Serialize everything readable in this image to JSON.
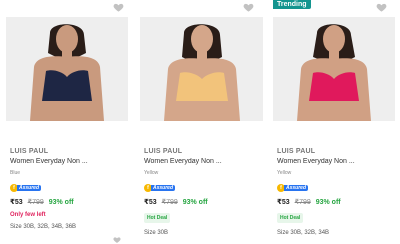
{
  "products": [
    {
      "brand": "LUIS PAUL",
      "title": "Women Everyday Non ...",
      "color": "Blue",
      "assured": "Assured",
      "price": "₹53",
      "mrp": "₹799",
      "off": "93% off",
      "tag": "Only few left",
      "sizes": "Size 30B, 32B, 34B, 36B",
      "bra_color": "#1e2644",
      "trending": ""
    },
    {
      "brand": "LUIS PAUL",
      "title": "Women Everyday Non ...",
      "color": "Yellow",
      "assured": "Assured",
      "price": "₹53",
      "mrp": "₹799",
      "off": "93% off",
      "tag": "Hot Deal",
      "sizes": "Size 30B",
      "bra_color": "#f2c37b",
      "trending": ""
    },
    {
      "brand": "LUIS PAUL",
      "title": "Women Everyday Non ...",
      "color": "Yellow",
      "assured": "Assured",
      "price": "₹53",
      "mrp": "₹799",
      "off": "93% off",
      "tag": "Hot Deal",
      "sizes": "Size 30B, 32B, 34B",
      "bra_color": "#e0195c",
      "trending": "Trending"
    }
  ],
  "colors": {
    "assured_blue": "#2874f0",
    "discount_green": "#26a541",
    "few_left_pink": "#e0245e",
    "trending_teal": "#14958f"
  }
}
